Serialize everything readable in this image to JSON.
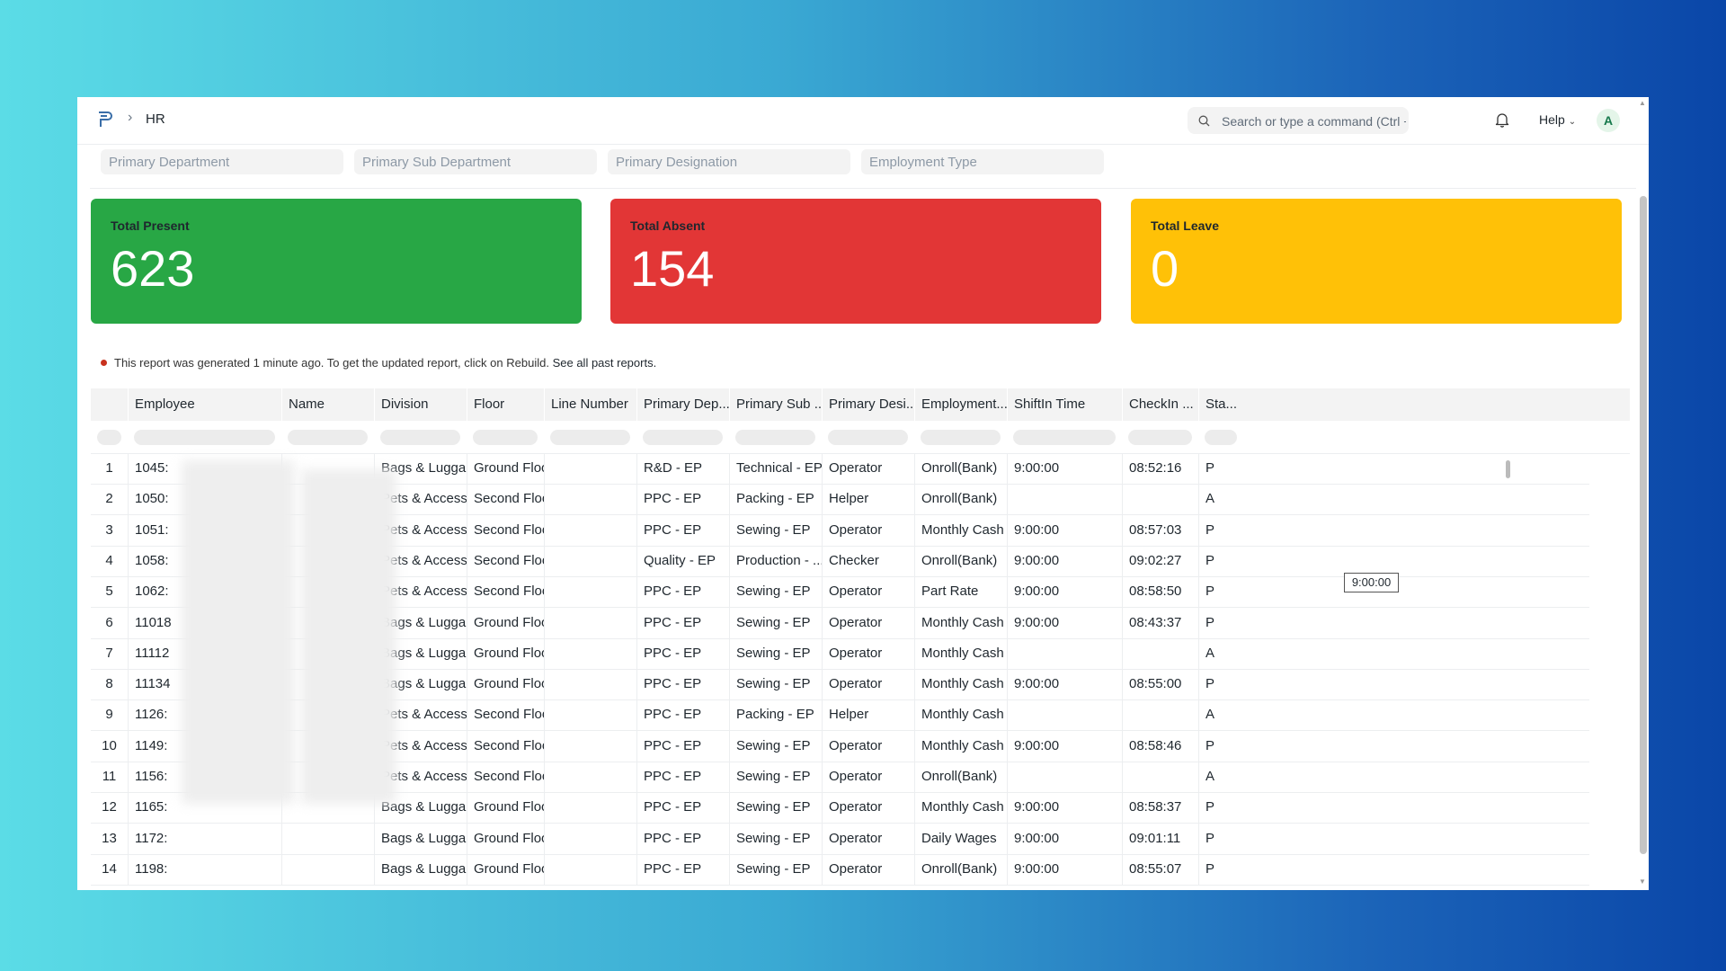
{
  "navbar": {
    "logo_icon": "frappe-logo-icon",
    "breadcrumb_sep": "›",
    "breadcrumb": "HR",
    "search_placeholder": "Search or type a command (Ctrl + G)",
    "help_label": "Help",
    "avatar_letter": "A"
  },
  "filters": [
    {
      "placeholder": "Primary Department"
    },
    {
      "placeholder": "Primary Sub Department"
    },
    {
      "placeholder": "Primary Designation"
    },
    {
      "placeholder": "Employment Type"
    }
  ],
  "cards": {
    "present": {
      "label": "Total Present",
      "value": "623",
      "color": "#28a745"
    },
    "absent": {
      "label": "Total Absent",
      "value": "154",
      "color": "#e23636"
    },
    "leave": {
      "label": "Total Leave",
      "value": "0",
      "color": "#ffc107"
    }
  },
  "note": {
    "text": "This report was generated 1 minute ago. To get the updated report, click on Rebuild.",
    "link": "See all past reports."
  },
  "table": {
    "columns": [
      "Employee",
      "Name",
      "Division",
      "Floor",
      "Line Number",
      "Primary Dep...",
      "Primary Sub ...",
      "Primary Desi...",
      "Employment...",
      "ShiftIn Time",
      "CheckIn ...",
      "Sta..."
    ],
    "rows": [
      {
        "idx": "1",
        "employee": "1045:",
        "division": "Bags & Lugga...",
        "floor": "Ground Floor",
        "line": "",
        "dep": "R&D - EP",
        "sub": "Technical - EP",
        "desig": "Operator",
        "emp": "Onroll(Bank)",
        "shift": "9:00:00",
        "checkin": "08:52:16",
        "status": "P"
      },
      {
        "idx": "2",
        "employee": "1050:",
        "division": "Pets & Access...",
        "floor": "Second Floor",
        "line": "",
        "dep": "PPC - EP",
        "sub": "Packing - EP",
        "desig": "Helper",
        "emp": "Onroll(Bank)",
        "shift": "",
        "checkin": "",
        "status": "A"
      },
      {
        "idx": "3",
        "employee": "1051:",
        "division": "Pets & Access...",
        "floor": "Second Floor",
        "line": "",
        "dep": "PPC - EP",
        "sub": "Sewing - EP",
        "desig": "Operator",
        "emp": "Monthly Cash",
        "shift": "9:00:00",
        "checkin": "08:57:03",
        "status": "P"
      },
      {
        "idx": "4",
        "employee": "1058:",
        "division": "Pets & Access...",
        "floor": "Second Floor",
        "line": "",
        "dep": "Quality - EP",
        "sub": "Production - ...",
        "desig": "Checker",
        "emp": "Onroll(Bank)",
        "shift": "9:00:00",
        "checkin": "09:02:27",
        "status": "P"
      },
      {
        "idx": "5",
        "employee": "1062:",
        "division": "Pets & Access...",
        "floor": "Second Floor",
        "line": "",
        "dep": "PPC - EP",
        "sub": "Sewing - EP",
        "desig": "Operator",
        "emp": "Part Rate",
        "shift": "9:00:00",
        "checkin": "08:58:50",
        "status": "P"
      },
      {
        "idx": "6",
        "employee": "11018",
        "division": "Bags & Lugga...",
        "floor": "Ground Floor",
        "line": "",
        "dep": "PPC - EP",
        "sub": "Sewing - EP",
        "desig": "Operator",
        "emp": "Monthly Cash",
        "shift": "9:00:00",
        "checkin": "08:43:37",
        "status": "P"
      },
      {
        "idx": "7",
        "employee": "11112",
        "division": "Bags & Lugga...",
        "floor": "Ground Floor",
        "line": "",
        "dep": "PPC - EP",
        "sub": "Sewing - EP",
        "desig": "Operator",
        "emp": "Monthly Cash",
        "shift": "",
        "checkin": "",
        "status": "A"
      },
      {
        "idx": "8",
        "employee": "11134",
        "division": "Bags & Lugga...",
        "floor": "Ground Floor",
        "line": "",
        "dep": "PPC - EP",
        "sub": "Sewing - EP",
        "desig": "Operator",
        "emp": "Monthly Cash",
        "shift": "9:00:00",
        "checkin": "08:55:00",
        "status": "P"
      },
      {
        "idx": "9",
        "employee": "1126:",
        "division": "Pets & Access...",
        "floor": "Second Floor",
        "line": "",
        "dep": "PPC - EP",
        "sub": "Packing - EP",
        "desig": "Helper",
        "emp": "Monthly Cash",
        "shift": "",
        "checkin": "",
        "status": "A"
      },
      {
        "idx": "10",
        "employee": "1149:",
        "division": "Pets & Access...",
        "floor": "Second Floor",
        "line": "",
        "dep": "PPC - EP",
        "sub": "Sewing - EP",
        "desig": "Operator",
        "emp": "Monthly Cash",
        "shift": "9:00:00",
        "checkin": "08:58:46",
        "status": "P"
      },
      {
        "idx": "11",
        "employee": "1156:",
        "division": "Pets & Access...",
        "floor": "Second Floor",
        "line": "",
        "dep": "PPC - EP",
        "sub": "Sewing - EP",
        "desig": "Operator",
        "emp": "Onroll(Bank)",
        "shift": "",
        "checkin": "",
        "status": "A"
      },
      {
        "idx": "12",
        "employee": "1165:",
        "division": "Bags & Lugga...",
        "floor": "Ground Floor",
        "line": "",
        "dep": "PPC - EP",
        "sub": "Sewing - EP",
        "desig": "Operator",
        "emp": "Monthly Cash",
        "shift": "9:00:00",
        "checkin": "08:58:37",
        "status": "P"
      },
      {
        "idx": "13",
        "employee": "1172:",
        "division": "Bags & Lugga...",
        "floor": "Ground Floor",
        "line": "",
        "dep": "PPC - EP",
        "sub": "Sewing - EP",
        "desig": "Operator",
        "emp": "Daily Wages",
        "shift": "9:00:00",
        "checkin": "09:01:11",
        "status": "P"
      },
      {
        "idx": "14",
        "employee": "1198:",
        "division": "Bags & Lugga...",
        "floor": "Ground Floor",
        "line": "",
        "dep": "PPC - EP",
        "sub": "Sewing - EP",
        "desig": "Operator",
        "emp": "Onroll(Bank)",
        "shift": "9:00:00",
        "checkin": "08:55:07",
        "status": "P"
      }
    ]
  },
  "tooltip": "9:00:00"
}
